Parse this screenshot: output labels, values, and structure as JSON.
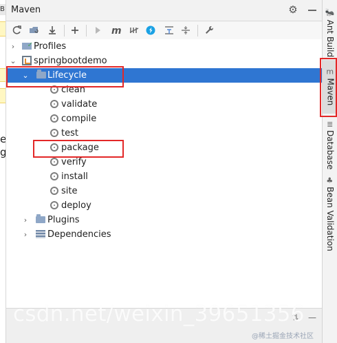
{
  "window": {
    "title": "Maven"
  },
  "left_editor_fragments": {
    "tab_fragment": "B",
    "text_1": "er",
    "text_2": "gt"
  },
  "toolbar": {
    "buttons": [
      {
        "name": "reload-all-projects-icon"
      },
      {
        "name": "reload-generated-sources-icon"
      },
      {
        "name": "download-sources-icon"
      },
      {
        "name": "add-maven-project-icon"
      },
      {
        "name": "run-maven-build-icon"
      },
      {
        "name": "execute-maven-goal-icon"
      },
      {
        "name": "toggle-offline-mode-icon"
      },
      {
        "name": "toggle-skip-tests-icon"
      },
      {
        "name": "show-dependencies-icon"
      },
      {
        "name": "expand-all-icon"
      },
      {
        "name": "collapse-all-icon"
      },
      {
        "name": "maven-settings-icon"
      }
    ]
  },
  "tree": {
    "profiles": "Profiles",
    "project": "springbootdemo",
    "lifecycle": "Lifecycle",
    "phases": [
      "clean",
      "validate",
      "compile",
      "test",
      "package",
      "verify",
      "install",
      "site",
      "deploy"
    ],
    "plugins": "Plugins",
    "dependencies": "Dependencies"
  },
  "right_tabs": {
    "ant": "Ant Build",
    "maven": "Maven",
    "database": "Database",
    "bean_validation": "Bean Validation"
  },
  "watermark": {
    "main": "csdn.net/weixin_39651356",
    "small": "@稀土掘金技术社区"
  },
  "colors": {
    "selection": "#2f76d2",
    "highlight_box": "#e32727"
  }
}
